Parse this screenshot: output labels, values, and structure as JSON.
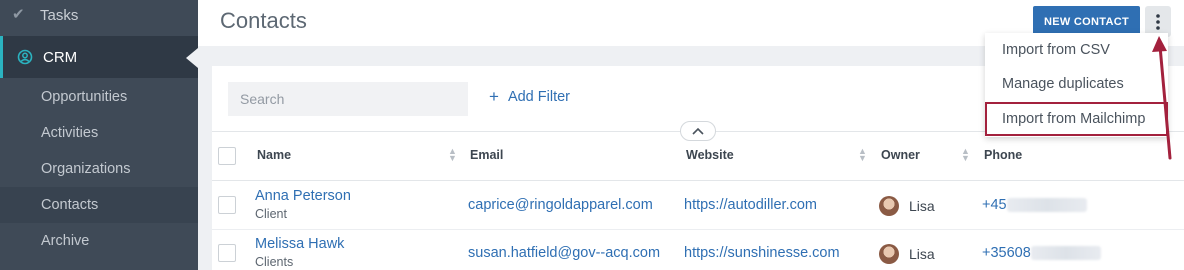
{
  "sidebar": {
    "tasks_label": "Tasks",
    "crm_label": "CRM",
    "items": [
      {
        "label": "Opportunities"
      },
      {
        "label": "Activities"
      },
      {
        "label": "Organizations"
      },
      {
        "label": "Contacts"
      },
      {
        "label": "Archive"
      }
    ]
  },
  "header": {
    "title": "Contacts",
    "new_contact_label": "NEW CONTACT"
  },
  "menu": {
    "items": [
      {
        "label": "Import from CSV"
      },
      {
        "label": "Manage duplicates"
      },
      {
        "label": "Import from Mailchimp"
      }
    ]
  },
  "toolbar": {
    "search_placeholder": "Search",
    "add_filter_label": "Add Filter"
  },
  "table": {
    "columns": [
      "Name",
      "Email",
      "Website",
      "Owner",
      "Phone"
    ],
    "rows": [
      {
        "name": "Anna Peterson",
        "type": "Client",
        "email": "caprice@ringoldapparel.com",
        "website": "https://autodiller.com",
        "owner": "Lisa",
        "phone": "+45"
      },
      {
        "name": "Melissa Hawk",
        "type": "Clients",
        "email": "susan.hatfield@gov--acq.com",
        "website": "https://sunshinesse.com",
        "owner": "Lisa",
        "phone": "+35608"
      }
    ]
  },
  "colors": {
    "accent": "#2f6fb3",
    "sidebar_bg": "#3f4a57",
    "crm_highlight": "#2bb3c0",
    "annotation": "#a3213d"
  },
  "icons": {
    "tasks": "checkmark-icon",
    "crm": "user-circle-icon",
    "more": "vertical-ellipsis-icon",
    "collapse": "chevron-up-icon"
  }
}
